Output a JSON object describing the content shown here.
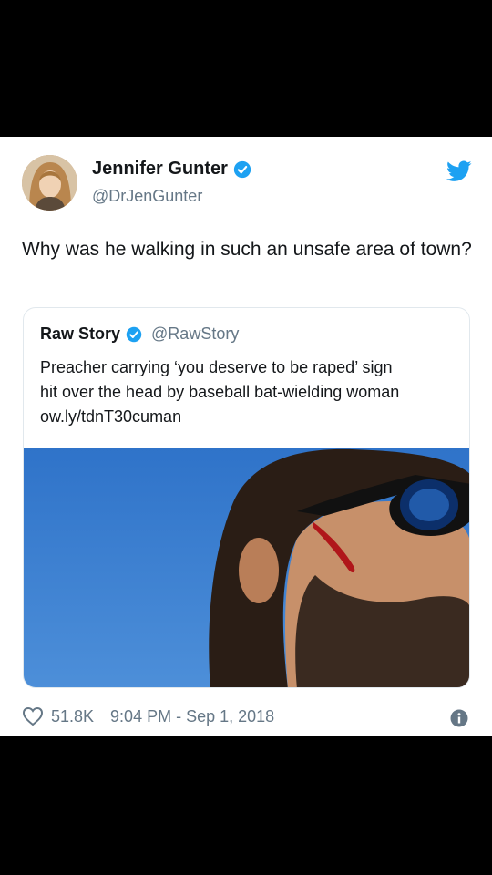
{
  "tweet": {
    "author_name": "Jennifer Gunter",
    "author_handle": "@DrJenGunter",
    "avatar_icon": "profile-photo",
    "verified_icon": "verified-badge-icon",
    "brand_icon": "twitter-bird-icon",
    "text": "Why was he walking in such an unsafe area of town?",
    "likes": "51.8K",
    "timestamp": "9:04 PM - Sep 1, 2018",
    "like_icon": "heart-icon",
    "info_icon": "info-icon"
  },
  "quoted_tweet": {
    "author_name": "Raw Story",
    "author_handle": "@RawStory",
    "line1": "Preacher carrying ‘you deserve to be raped’ sign",
    "line2": "hit over the head by baseball bat-wielding woman",
    "line3": "ow.ly/tdnT30cuman",
    "image_icon": "man-with-sunglasses-photo"
  },
  "colors": {
    "background": "#000000",
    "card": "#ffffff",
    "brand_blue": "#1da1f2",
    "text_primary": "#14171a",
    "text_secondary": "#657786"
  }
}
